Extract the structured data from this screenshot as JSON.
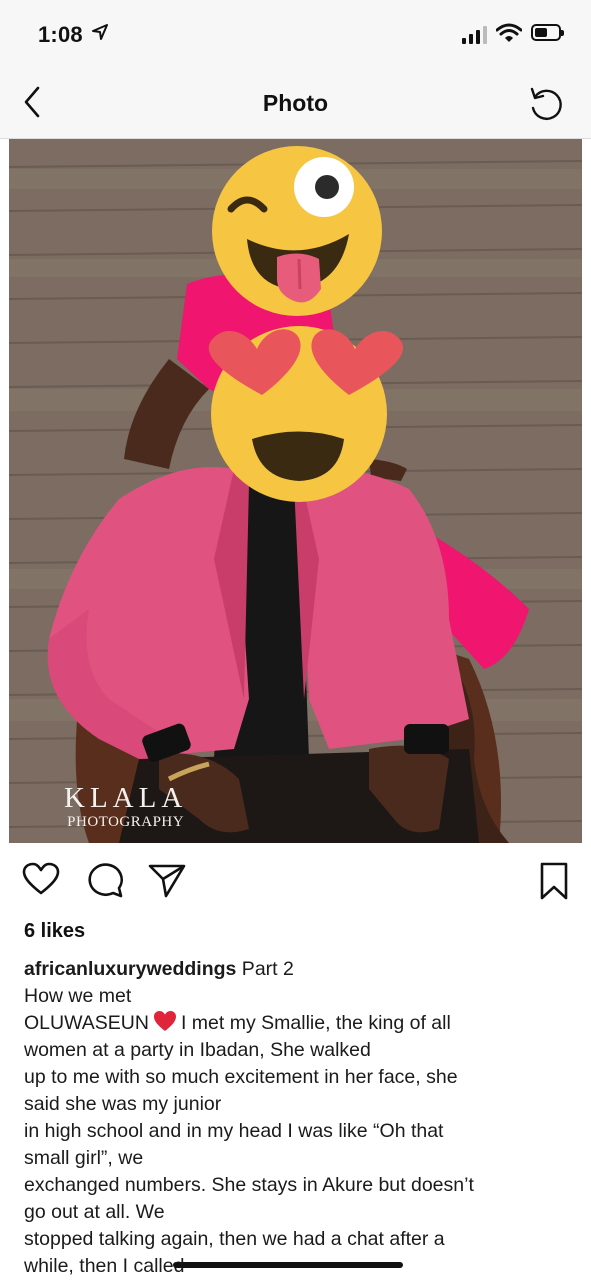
{
  "status": {
    "time": "1:08"
  },
  "nav": {
    "title": "Photo"
  },
  "photo": {
    "watermark": "KLALA",
    "watermark_sub": "PHOTOGRAPHY",
    "emoji_top": "winking-face-with-tongue-emoji",
    "emoji_bottom": "smiling-face-with-heart-eyes-emoji"
  },
  "actions": {
    "like_icon": "heart-outline-icon",
    "comment_icon": "comment-icon",
    "share_icon": "send-icon",
    "save_icon": "bookmark-icon"
  },
  "post": {
    "likes": "6 likes",
    "username": "africanluxuryweddings",
    "caption_start": " Part 2",
    "lines": {
      "l1": "How we met",
      "l2a": "OLUWASEUN",
      "l2b": "I met my Smallie, the king of all",
      "l3": "women at a party in Ibadan, She walked",
      "l4": "up to me with so much excitement in her face, she",
      "l5": "said she was my junior",
      "l6": "in high school and in my head I was like “Oh that",
      "l7": "small girl”, we",
      "l8": "exchanged numbers. She stays in Akure but doesn’t",
      "l9": "go out at all. We",
      "l10": "stopped talking again, then we had a chat after a",
      "l11": "while, then I called"
    }
  },
  "colors": {
    "blazer": "#e0527f",
    "dress": "#f0156f",
    "emoji": "#f6c643",
    "heart": "#e8565c",
    "tongue": "#e85c7b"
  }
}
